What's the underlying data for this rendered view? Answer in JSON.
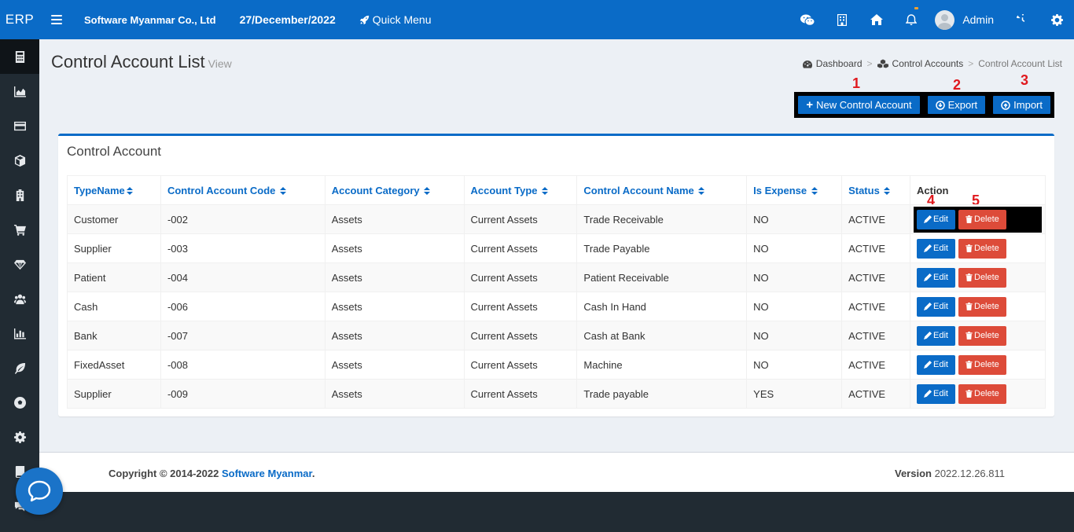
{
  "app": {
    "brand": "ERP"
  },
  "header": {
    "company": "Software Myanmar Co., Ltd",
    "date": "27/December/2022",
    "quick_menu": "Quick Menu",
    "user_name": "Admin"
  },
  "page": {
    "title": "Control Account List",
    "subtitle": "View",
    "breadcrumb": [
      {
        "label": "Dashboard"
      },
      {
        "label": "Control Accounts"
      },
      {
        "label": "Control Account List"
      }
    ],
    "buttons": {
      "new": "New Control Account",
      "export": "Export",
      "import": "Import"
    },
    "markers": [
      "1",
      "2",
      "3",
      "4",
      "5"
    ]
  },
  "table": {
    "title": "Control Account",
    "columns": [
      "TypeName",
      "Control Account Code",
      "Account Category",
      "Account Type",
      "Control Account Name",
      "Is Expense",
      "Status",
      "Action"
    ],
    "edit_label": "Edit",
    "delete_label": "Delete",
    "rows": [
      [
        "Customer",
        "-002",
        "Assets",
        "Current Assets",
        "Trade Receivable",
        "NO",
        "ACTIVE"
      ],
      [
        "Supplier",
        "-003",
        "Assets",
        "Current Assets",
        "Trade Payable",
        "NO",
        "ACTIVE"
      ],
      [
        "Patient",
        "-004",
        "Assets",
        "Current Assets",
        "Patient Receivable",
        "NO",
        "ACTIVE"
      ],
      [
        "Cash",
        "-006",
        "Assets",
        "Current Assets",
        "Cash In Hand",
        "NO",
        "ACTIVE"
      ],
      [
        "Bank",
        "-007",
        "Assets",
        "Current Assets",
        "Cash at Bank",
        "NO",
        "ACTIVE"
      ],
      [
        "FixedAsset",
        "-008",
        "Assets",
        "Current Assets",
        "Machine",
        "NO",
        "ACTIVE"
      ],
      [
        "Supplier",
        "-009",
        "Assets",
        "Current Assets",
        "Trade payable",
        "YES",
        "ACTIVE"
      ]
    ]
  },
  "footer": {
    "copyright": "Copyright © 2014-2022",
    "company_link": "Software Myanmar",
    "period": ".",
    "version_label": "Version",
    "version": "2022.12.26.811"
  },
  "colors": {
    "primary": "#0a6bc7",
    "danger": "#dd4b39",
    "sidebar": "#212b33",
    "marker": "#e0191e"
  },
  "icons": {
    "sidebar": [
      "calculator-icon",
      "area-chart-icon",
      "credit-card-icon",
      "cube-icon",
      "building-icon",
      "cart-icon",
      "diamond-icon",
      "users-icon",
      "bar-chart-icon",
      "leaf-icon",
      "soccer-ball-icon",
      "gear-icon",
      "book-icon",
      "comments-icon"
    ]
  }
}
